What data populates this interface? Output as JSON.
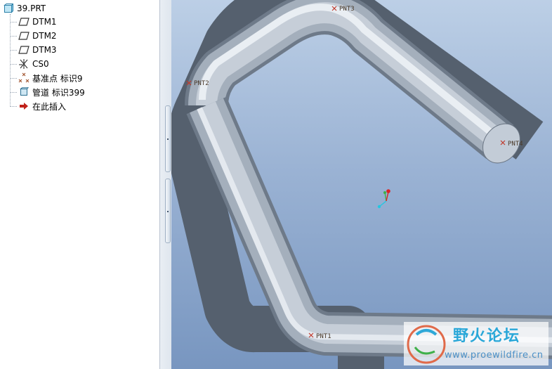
{
  "model_tree": {
    "root": "39.PRT",
    "items": [
      {
        "label": "DTM1",
        "icon": "datum-plane-icon"
      },
      {
        "label": "DTM2",
        "icon": "datum-plane-icon"
      },
      {
        "label": "DTM3",
        "icon": "datum-plane-icon"
      },
      {
        "label": "CS0",
        "icon": "coordinate-system-icon"
      },
      {
        "label": "基准点 标识9",
        "icon": "datum-points-icon"
      },
      {
        "label": "管道 标识399",
        "icon": "pipe-feature-icon"
      },
      {
        "label": "在此插入",
        "icon": "insert-here-arrow-icon"
      }
    ]
  },
  "viewport": {
    "datum_points": {
      "pnt1": "PNT1",
      "pnt2": "PNT2",
      "pnt3": "PNT3",
      "pnt4": "PNT4"
    }
  },
  "watermark": {
    "title": "野火论坛",
    "url": "www.proewildfire.cn"
  },
  "colors": {
    "viewport_top": "#bccfe6",
    "viewport_bottom": "#7896c0",
    "pipe_body": "#a9b3bf",
    "datum_point": "#c0392b",
    "watermark_accent": "#29a7d8"
  }
}
